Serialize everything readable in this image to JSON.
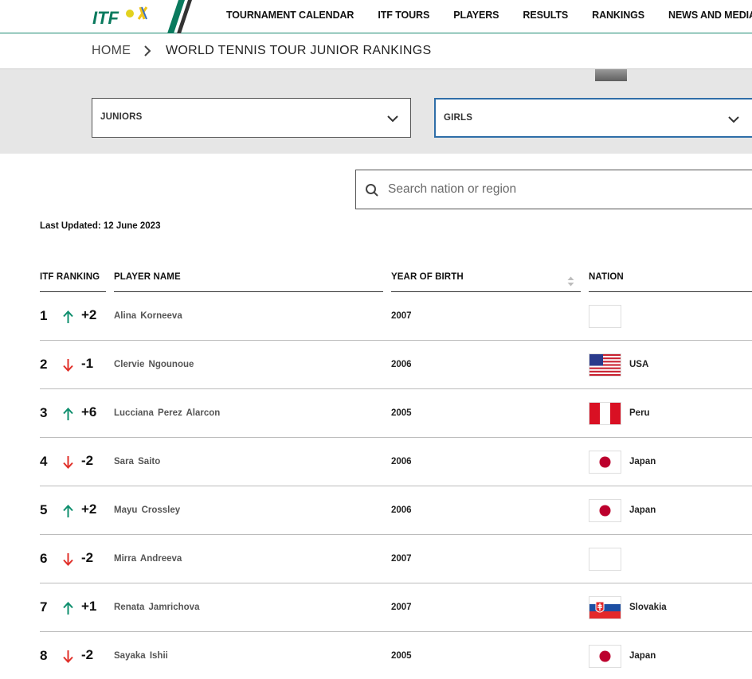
{
  "header": {
    "logo_text": "ITF",
    "nav": [
      "TOURNAMENT CALENDAR",
      "ITF TOURS",
      "PLAYERS",
      "RESULTS",
      "RANKINGS",
      "NEWS AND MEDIA"
    ]
  },
  "breadcrumb": {
    "home": "HOME",
    "current": "WORLD TENNIS TOUR JUNIOR RANKINGS"
  },
  "filters": {
    "category": "JUNIORS",
    "gender": "GIRLS"
  },
  "search": {
    "placeholder": "Search nation or region",
    "value": ""
  },
  "last_updated": "Last Updated: 12 June 2023",
  "table": {
    "headers": {
      "rank": "ITF RANKING",
      "player": "PLAYER NAME",
      "yob": "YEAR OF BIRTH",
      "nation": "NATION"
    },
    "rows": [
      {
        "rank": "1",
        "direction": "up",
        "move": "+2",
        "player": "Alina  Korneeva",
        "yob": "2007",
        "flag": "blank",
        "nation": ""
      },
      {
        "rank": "2",
        "direction": "down",
        "move": "-1",
        "player": "Clervie  Ngounoue",
        "yob": "2006",
        "flag": "usa",
        "nation": "USA"
      },
      {
        "rank": "3",
        "direction": "up",
        "move": "+6",
        "player": "Lucciana  Perez Alarcon",
        "yob": "2005",
        "flag": "peru",
        "nation": "Peru"
      },
      {
        "rank": "4",
        "direction": "down",
        "move": "-2",
        "player": "Sara  Saito",
        "yob": "2006",
        "flag": "japan",
        "nation": "Japan"
      },
      {
        "rank": "5",
        "direction": "up",
        "move": "+2",
        "player": "Mayu  Crossley",
        "yob": "2006",
        "flag": "japan",
        "nation": "Japan"
      },
      {
        "rank": "6",
        "direction": "down",
        "move": "-2",
        "player": "Mirra  Andreeva",
        "yob": "2007",
        "flag": "blank",
        "nation": ""
      },
      {
        "rank": "7",
        "direction": "up",
        "move": "+1",
        "player": "Renata  Jamrichova",
        "yob": "2007",
        "flag": "slovakia",
        "nation": "Slovakia"
      },
      {
        "rank": "8",
        "direction": "down",
        "move": "-2",
        "player": "Sayaka  Ishii",
        "yob": "2005",
        "flag": "japan",
        "nation": "Japan"
      }
    ]
  },
  "colors": {
    "brand_green": "#0a7a5e",
    "up_arrow": "#0f8f6e",
    "down_arrow": "#e0302a",
    "filter_band": "#e6e6e6",
    "select_focus": "#2f6ea8"
  }
}
